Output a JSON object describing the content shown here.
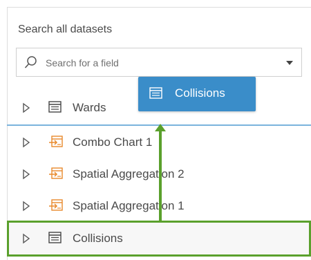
{
  "search": {
    "label": "Search all datasets",
    "placeholder": "Search for a field"
  },
  "datasets": [
    {
      "label": "Wards",
      "icon": "table-icon"
    },
    {
      "label": "Combo Chart 1",
      "icon": "result-dataset-icon"
    },
    {
      "label": "Spatial Aggregation 2",
      "icon": "result-dataset-icon"
    },
    {
      "label": "Spatial Aggregation 1",
      "icon": "result-dataset-icon"
    },
    {
      "label": "Collisions",
      "icon": "table-icon"
    }
  ],
  "drag": {
    "label": "Collisions",
    "icon": "table-icon"
  },
  "colors": {
    "accent_blue": "#3a8dc9",
    "drop_indicator": "#7ab3dd",
    "highlight_green": "#5aa02c",
    "result_icon_orange": "#e8892b"
  }
}
